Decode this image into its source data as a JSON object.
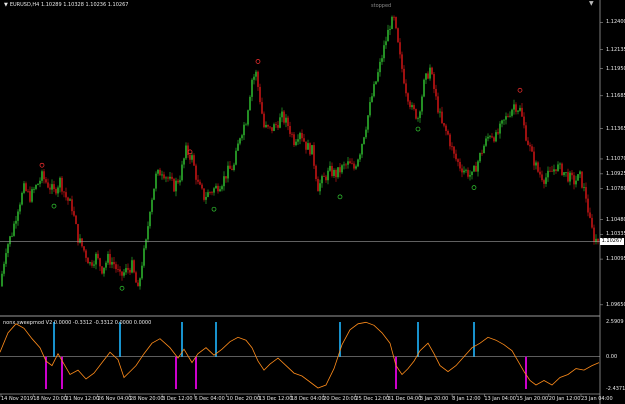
{
  "header": {
    "symbol_line": "EURUSD,H4  1.10289 1.10328 1.10236 1.10267",
    "arrow_glyph": "▼",
    "status": "stopped",
    "corner_glyph": "▼"
  },
  "indicator": {
    "title": "nonx sweepmod V2 0.0000 -0.3312 -0.3312 0.0000 0.0000",
    "scale_labels": [
      "2.5909",
      "0.00",
      "-2.4371"
    ]
  },
  "price_axis": {
    "labels": [
      "1.12400",
      "1.12135",
      "1.11950",
      "1.11685",
      "1.11365",
      "1.11070",
      "1.10925",
      "1.10780",
      "1.10480",
      "1.10335",
      "1.10095",
      "1.09650"
    ],
    "current_price": "1.10267"
  },
  "time_axis": {
    "labels": [
      "14 Nov 2019",
      "18 Nov 20:00",
      "21 Nov 12:00",
      "26 Nov 04:00",
      "28 Nov 20:00",
      "3 Dec 12:00",
      "6 Dec 04:00",
      "10 Dec 20:00",
      "13 Dec 12:00",
      "18 Dec 04:00",
      "20 Dec 20:00",
      "25 Dec 12:00",
      "31 Dec 04:00",
      "3 Jan 20:00",
      "8 Jan 12:00",
      "13 Jan 04:00",
      "15 Jan 20:00",
      "20 Jan 12:00",
      "23 Jan 04:00"
    ]
  },
  "colors": {
    "background": "#000000",
    "bull": "#33cc33",
    "bear": "#e01818",
    "separator": "#9a9a9a",
    "current_line": "#9a9a9a",
    "osc_line": "#ff8c1a",
    "arrow_up_color": "#00e0e0",
    "arrow_dn_color": "#ff20ff",
    "signal_top": "#1fb6ff",
    "signal_bottom": "#ff00ff",
    "marker_top_color": "#ff3030",
    "marker_bottom_color": "#33cc33"
  },
  "chart_data": {
    "type": "candlestick",
    "price_range": [
      1.0958,
      1.1252
    ],
    "closes_path": [
      [
        0,
        1.0983
      ],
      [
        6,
        1.102
      ],
      [
        12,
        1.1035
      ],
      [
        18,
        1.106
      ],
      [
        24,
        1.1078
      ],
      [
        30,
        1.107
      ],
      [
        36,
        1.108
      ],
      [
        42,
        1.109
      ],
      [
        48,
        1.1082
      ],
      [
        54,
        1.1075
      ],
      [
        60,
        1.1086
      ],
      [
        66,
        1.107
      ],
      [
        72,
        1.106
      ],
      [
        78,
        1.103
      ],
      [
        84,
        1.1018
      ],
      [
        90,
        1.1005
      ],
      [
        96,
        1.1012
      ],
      [
        102,
        1.1
      ],
      [
        108,
        1.101
      ],
      [
        114,
        1.1005
      ],
      [
        120,
        1.0992
      ],
      [
        126,
        1.0998
      ],
      [
        132,
        1.1003
      ],
      [
        138,
        1.0978
      ],
      [
        142,
        1.1006
      ],
      [
        146,
        1.1025
      ],
      [
        150,
        1.106
      ],
      [
        156,
        1.109
      ],
      [
        162,
        1.1096
      ],
      [
        168,
        1.1088
      ],
      [
        174,
        1.108
      ],
      [
        180,
        1.109
      ],
      [
        186,
        1.1115
      ],
      [
        192,
        1.1108
      ],
      [
        198,
        1.1082
      ],
      [
        204,
        1.107
      ],
      [
        210,
        1.1075
      ],
      [
        216,
        1.1079
      ],
      [
        222,
        1.1085
      ],
      [
        228,
        1.1095
      ],
      [
        234,
        1.11
      ],
      [
        240,
        1.113
      ],
      [
        246,
        1.1145
      ],
      [
        252,
        1.1185
      ],
      [
        256,
        1.119
      ],
      [
        260,
        1.1165
      ],
      [
        264,
        1.1138
      ],
      [
        270,
        1.1135
      ],
      [
        276,
        1.114
      ],
      [
        282,
        1.1148
      ],
      [
        288,
        1.114
      ],
      [
        294,
        1.1125
      ],
      [
        300,
        1.1135
      ],
      [
        306,
        1.112
      ],
      [
        312,
        1.1115
      ],
      [
        318,
        1.108
      ],
      [
        324,
        1.1088
      ],
      [
        330,
        1.1095
      ],
      [
        336,
        1.1092
      ],
      [
        342,
        1.1098
      ],
      [
        348,
        1.1102
      ],
      [
        354,
        1.1098
      ],
      [
        360,
        1.1115
      ],
      [
        366,
        1.114
      ],
      [
        372,
        1.1168
      ],
      [
        378,
        1.119
      ],
      [
        384,
        1.1215
      ],
      [
        390,
        1.1238
      ],
      [
        394,
        1.1242
      ],
      [
        400,
        1.1205
      ],
      [
        406,
        1.1175
      ],
      [
        412,
        1.1155
      ],
      [
        418,
        1.1148
      ],
      [
        424,
        1.118
      ],
      [
        430,
        1.1195
      ],
      [
        436,
        1.1165
      ],
      [
        442,
        1.114
      ],
      [
        448,
        1.113
      ],
      [
        454,
        1.111
      ],
      [
        460,
        1.11
      ],
      [
        466,
        1.1095
      ],
      [
        472,
        1.109
      ],
      [
        478,
        1.1105
      ],
      [
        484,
        1.112
      ],
      [
        490,
        1.1132
      ],
      [
        496,
        1.1128
      ],
      [
        502,
        1.114
      ],
      [
        508,
        1.115
      ],
      [
        514,
        1.116
      ],
      [
        520,
        1.1155
      ],
      [
        526,
        1.113
      ],
      [
        532,
        1.111
      ],
      [
        538,
        1.1095
      ],
      [
        544,
        1.1088
      ],
      [
        550,
        1.1092
      ],
      [
        556,
        1.11
      ],
      [
        562,
        1.1096
      ],
      [
        568,
        1.109
      ],
      [
        574,
        1.1085
      ],
      [
        580,
        1.109
      ],
      [
        586,
        1.107
      ],
      [
        590,
        1.1045
      ],
      [
        594,
        1.103
      ],
      [
        599,
        1.10267
      ]
    ],
    "markers_top": [
      [
        42,
        1.1097
      ],
      [
        190,
        1.111
      ],
      [
        258,
        1.1198
      ],
      [
        520,
        1.117
      ]
    ],
    "markers_bottom": [
      [
        54,
        1.1065
      ],
      [
        122,
        1.0985
      ],
      [
        214,
        1.1062
      ],
      [
        340,
        1.1074
      ],
      [
        418,
        1.114
      ],
      [
        474,
        1.1083
      ]
    ],
    "oscillator": {
      "range": [
        -2.4371,
        2.5909
      ],
      "points": [
        [
          0,
          0.3
        ],
        [
          8,
          1.6
        ],
        [
          16,
          2.2
        ],
        [
          24,
          1.9
        ],
        [
          32,
          1.2
        ],
        [
          40,
          0.6
        ],
        [
          46,
          -0.3
        ],
        [
          52,
          -0.6
        ],
        [
          58,
          0.2
        ],
        [
          64,
          -0.5
        ],
        [
          70,
          -1.2
        ],
        [
          78,
          -0.9
        ],
        [
          86,
          -1.5
        ],
        [
          94,
          -1.1
        ],
        [
          102,
          -0.4
        ],
        [
          110,
          0.3
        ],
        [
          118,
          -0.2
        ],
        [
          124,
          -1.4
        ],
        [
          130,
          -1.0
        ],
        [
          136,
          -0.6
        ],
        [
          144,
          0.2
        ],
        [
          152,
          0.9
        ],
        [
          160,
          1.2
        ],
        [
          170,
          0.6
        ],
        [
          178,
          -0.1
        ],
        [
          184,
          0.5
        ],
        [
          192,
          -0.4
        ],
        [
          198,
          0.2
        ],
        [
          206,
          0.6
        ],
        [
          214,
          0.1
        ],
        [
          222,
          0.5
        ],
        [
          230,
          1.0
        ],
        [
          238,
          1.3
        ],
        [
          246,
          1.1
        ],
        [
          252,
          0.6
        ],
        [
          258,
          -0.3
        ],
        [
          264,
          -0.9
        ],
        [
          270,
          -0.5
        ],
        [
          278,
          -0.1
        ],
        [
          286,
          -0.6
        ],
        [
          294,
          -1.1
        ],
        [
          302,
          -1.3
        ],
        [
          310,
          -1.7
        ],
        [
          318,
          -2.1
        ],
        [
          326,
          -1.9
        ],
        [
          334,
          -0.8
        ],
        [
          342,
          0.8
        ],
        [
          350,
          1.8
        ],
        [
          358,
          2.2
        ],
        [
          366,
          2.3
        ],
        [
          374,
          2.1
        ],
        [
          382,
          1.6
        ],
        [
          390,
          0.9
        ],
        [
          396,
          -0.6
        ],
        [
          402,
          -1.2
        ],
        [
          408,
          -0.8
        ],
        [
          414,
          -0.3
        ],
        [
          420,
          0.4
        ],
        [
          428,
          0.9
        ],
        [
          434,
          0.2
        ],
        [
          440,
          -0.6
        ],
        [
          448,
          -1.0
        ],
        [
          456,
          -0.6
        ],
        [
          464,
          0.0
        ],
        [
          472,
          0.6
        ],
        [
          480,
          0.9
        ],
        [
          488,
          1.3
        ],
        [
          496,
          1.1
        ],
        [
          504,
          0.8
        ],
        [
          512,
          0.4
        ],
        [
          518,
          -0.3
        ],
        [
          524,
          -1.0
        ],
        [
          530,
          -1.6
        ],
        [
          536,
          -1.9
        ],
        [
          544,
          -1.6
        ],
        [
          552,
          -1.9
        ],
        [
          560,
          -1.4
        ],
        [
          568,
          -1.2
        ],
        [
          576,
          -0.8
        ],
        [
          584,
          -0.9
        ],
        [
          592,
          -0.6
        ],
        [
          599,
          -0.4
        ]
      ],
      "up_arrows": [
        54,
        120,
        182,
        216,
        340,
        418,
        474
      ],
      "down_arrows": [
        46,
        62,
        176,
        196,
        396,
        526
      ]
    }
  }
}
